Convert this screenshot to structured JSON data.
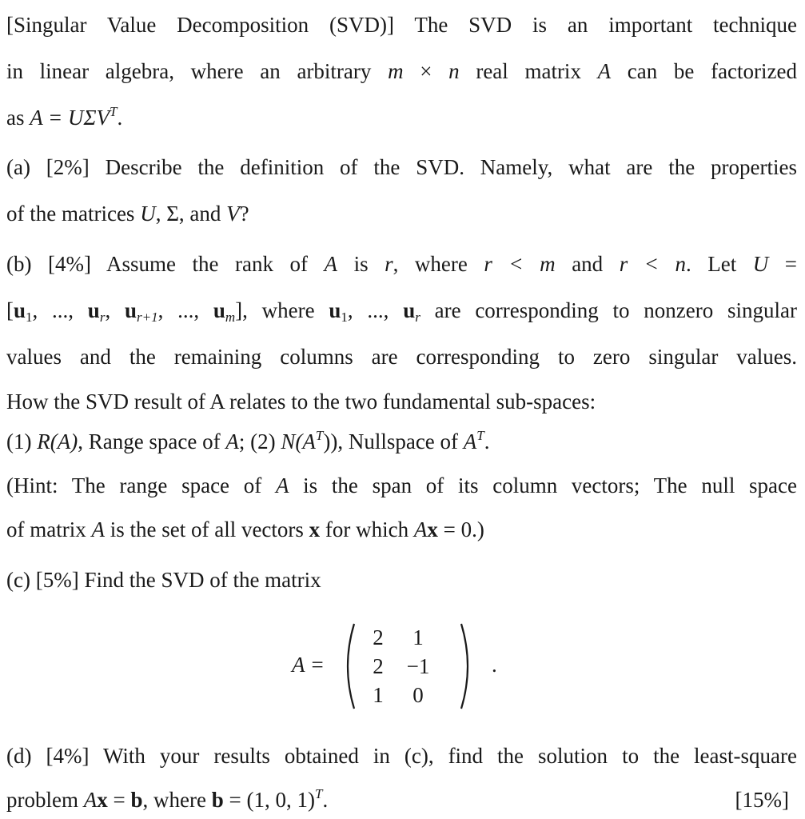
{
  "intro": {
    "line1": "[Singular Value Decomposition (SVD)] The SVD is an important technique",
    "line2a": "in linear algebra, where an arbitrary ",
    "line2_m": "m",
    "line2_times": " × ",
    "line2_n": "n",
    "line2b": " real matrix ",
    "line2_A": "A",
    "line2c": " can be factorized",
    "line3a": "as ",
    "line3_eq": "A = UΣV",
    "line3_sup": "T",
    "line3b": "."
  },
  "part_a": {
    "line1": "(a) [2%] Describe the definition of the SVD. Namely, what are the properties",
    "line2a": "of the matrices ",
    "U": "U",
    "sep1": ", Σ, and ",
    "V": "V",
    "line2b": "?"
  },
  "part_b": {
    "line1a": "(b) [4%] Assume the rank of ",
    "A": "A",
    "line1b": " is ",
    "r1": "r",
    "line1c": ", where ",
    "cond1": "r < m",
    "line1d": " and ",
    "cond2": "r < n",
    "line1e": ".  Let ",
    "U": "U",
    "line1f": " =",
    "line2_open": "[",
    "u": "u",
    "sub1": "1",
    "dots": ", ..., ",
    "subr": "r",
    "subr1": "r+1",
    "subm": "m",
    "line2_close": "], where ",
    "line2_tail": " are corresponding to nonzero singular",
    "line3": "values and the remaining columns are corresponding to zero singular values.",
    "line4": "How the SVD result of A relates to the two fundamental sub-spaces:",
    "line5a": "(1) ",
    "RA": "R(A)",
    "line5b": ", Range space of ",
    "line5c": ";     (2) ",
    "NAT": "N(A",
    "line5d": "), Nullspace of ",
    "line5e": ".",
    "line6a": "(Hint: The range space of ",
    "line6b": " is the span of its column vectors; The null space",
    "line7a": "of matrix ",
    "line7b": " is the set of all vectors ",
    "x": "x",
    "line7c": " for which ",
    "Ax": "A",
    "line7d": " = 0.)"
  },
  "part_c": {
    "line1": "(c) [5%] Find the SVD of the matrix",
    "lhs": "A =",
    "matrix": [
      [
        "2",
        "1"
      ],
      [
        "2",
        "−1"
      ],
      [
        "1",
        "0"
      ]
    ],
    "period": "."
  },
  "part_d": {
    "line1": "(d) [4%] With your results obtained in (c), find the solution to the least-square",
    "line2a": "problem ",
    "A": "A",
    "x": "x",
    "eq": " = ",
    "b": "b",
    "line2b": ", where ",
    "bval": " = (1, 0, 1)",
    "sup": "T",
    "line2c": ".",
    "total": "[15%]"
  }
}
